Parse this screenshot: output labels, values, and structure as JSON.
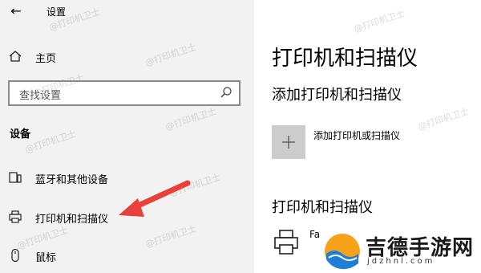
{
  "window": {
    "back_glyph": "←",
    "title": "设置"
  },
  "sidebar": {
    "home": {
      "icon": "home-icon",
      "label": "主页"
    },
    "search": {
      "placeholder": "查找设置",
      "icon": "search-icon"
    },
    "group_label": "设备",
    "items": [
      {
        "icon": "bluetooth-devices-icon",
        "label": "蓝牙和其他设备"
      },
      {
        "icon": "printer-icon",
        "label": "打印机和扫描仪",
        "selected": true
      },
      {
        "icon": "mouse-icon",
        "label": "鼠标"
      }
    ]
  },
  "main": {
    "title": "打印机和扫描仪",
    "add_section_heading": "添加打印机和扫描仪",
    "add_button": {
      "icon": "plus-icon",
      "label": "添加打印机或扫描仪"
    },
    "list_section_heading": "打印机和扫描仪",
    "printers": [
      {
        "icon": "printer-icon",
        "name": "Fa"
      }
    ]
  },
  "watermark_text": "@打印机卫士",
  "annotation": {
    "type": "arrow",
    "color": "#e8403a",
    "points_to": "打印机和扫描仪"
  },
  "site_logo": {
    "name": "吉德手游网",
    "url": "jdzhnl.com"
  },
  "colors": {
    "sidebar_bg": "#f2f2f2",
    "main_bg": "#ffffff",
    "add_tile_bg": "#cccccc",
    "arrow": "#e8403a"
  }
}
